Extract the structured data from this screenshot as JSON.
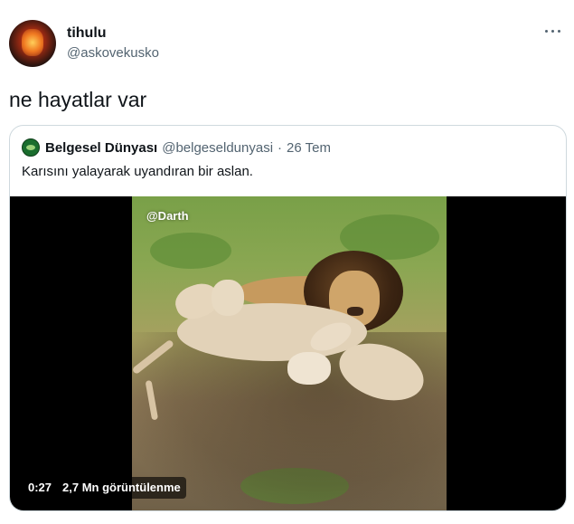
{
  "author": {
    "display_name": "tihulu",
    "handle": "@askovekusko",
    "avatar_icon": "flame-avatar-icon"
  },
  "more_icon": "more-options-icon",
  "tweet": {
    "text": "ne hayatlar var"
  },
  "quote": {
    "author_name": "Belgesel Dünyası",
    "author_handle": "@belgeseldunyasi",
    "separator": "·",
    "date": "26 Tem",
    "text": "Karısını yalayarak uyandıran bir aslan.",
    "video": {
      "watermark": "@Darth",
      "time": "0:27",
      "views": "2,7 Mn görüntülenme"
    }
  }
}
